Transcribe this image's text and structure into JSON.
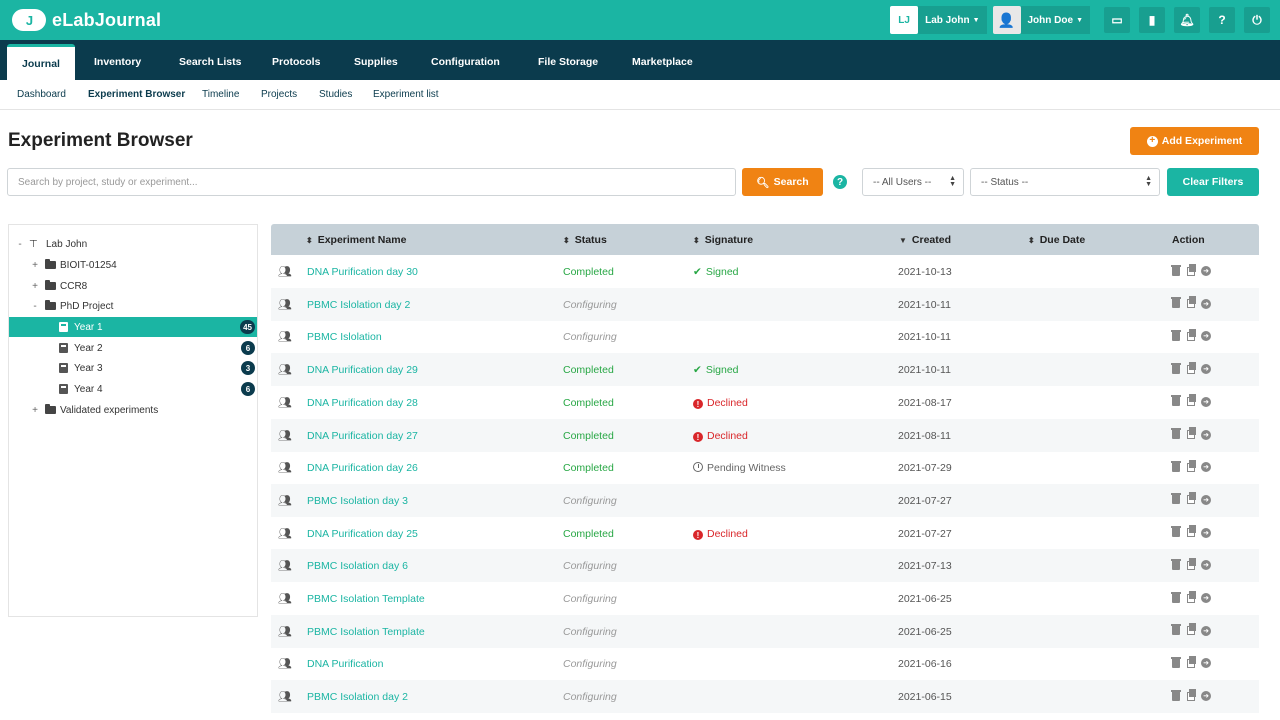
{
  "app": {
    "logo_mark": "J",
    "name": "eLabJournal"
  },
  "header": {
    "lab_avatar": "LJ",
    "lab_label": "Lab John",
    "user_label": "John Doe",
    "icons": [
      "inbox-icon",
      "chat-icon",
      "bell-icon",
      "help-icon",
      "power-icon"
    ]
  },
  "nav": {
    "tabs": [
      {
        "label": "Journal",
        "active": true
      },
      {
        "label": "Inventory"
      },
      {
        "label": "Search Lists"
      },
      {
        "label": "Protocols"
      },
      {
        "label": "Supplies"
      },
      {
        "label": "Configuration"
      },
      {
        "label": "File Storage"
      },
      {
        "label": "Marketplace"
      }
    ]
  },
  "subnav": {
    "items": [
      {
        "label": "Dashboard"
      },
      {
        "label": "Experiment Browser",
        "active": true
      },
      {
        "label": "Timeline"
      },
      {
        "label": "Projects"
      },
      {
        "label": "Studies"
      },
      {
        "label": "Experiment list"
      }
    ]
  },
  "page": {
    "title": "Experiment Browser",
    "add_label": "Add Experiment",
    "search_placeholder": "Search by project, study or experiment...",
    "search_label": "Search",
    "users_filter": "-- All Users --",
    "status_filter": "-- Status --",
    "clear_label": "Clear Filters"
  },
  "tree": {
    "items": [
      {
        "label": "Lab John",
        "toggle": "-",
        "icon": "sitemap-icon"
      },
      {
        "label": "BIOIT-01254",
        "toggle": "+",
        "icon": "folder-icon"
      },
      {
        "label": "CCR8",
        "toggle": "+",
        "icon": "folder-icon"
      },
      {
        "label": "PhD Project",
        "toggle": "-",
        "icon": "folder-icon"
      },
      {
        "label": "Year 1",
        "icon": "book-icon",
        "badge": "45",
        "selected": true
      },
      {
        "label": "Year 2",
        "icon": "book-icon",
        "badge": "6"
      },
      {
        "label": "Year 3",
        "icon": "book-icon",
        "badge": "3"
      },
      {
        "label": "Year 4",
        "icon": "book-icon",
        "badge": "6"
      },
      {
        "label": "Validated experiments",
        "toggle": "+",
        "icon": "folder-icon"
      }
    ]
  },
  "table": {
    "columns": {
      "name": "Experiment Name",
      "status": "Status",
      "signature": "Signature",
      "created": "Created",
      "due": "Due Date",
      "action": "Action"
    },
    "rows": [
      {
        "name": "DNA Purification day 30",
        "status": "Completed",
        "signature": "Signed",
        "sig_type": "signed",
        "created": "2021-10-13"
      },
      {
        "name": "PBMC Islolation day 2",
        "status": "Configuring",
        "signature": "",
        "sig_type": "",
        "created": "2021-10-11"
      },
      {
        "name": "PBMC Islolation",
        "status": "Configuring",
        "signature": "",
        "sig_type": "",
        "created": "2021-10-11"
      },
      {
        "name": "DNA Purification day 29",
        "status": "Completed",
        "signature": "Signed",
        "sig_type": "signed",
        "created": "2021-10-11"
      },
      {
        "name": "DNA Purification day 28",
        "status": "Completed",
        "signature": "Declined",
        "sig_type": "declined",
        "created": "2021-08-17"
      },
      {
        "name": "DNA Purification day 27",
        "status": "Completed",
        "signature": "Declined",
        "sig_type": "declined",
        "created": "2021-08-11"
      },
      {
        "name": "DNA Purification day 26",
        "status": "Completed",
        "signature": "Pending Witness",
        "sig_type": "pending",
        "created": "2021-07-29"
      },
      {
        "name": "PBMC Isolation day 3",
        "status": "Configuring",
        "signature": "",
        "sig_type": "",
        "created": "2021-07-27"
      },
      {
        "name": "DNA Purification day 25",
        "status": "Completed",
        "signature": "Declined",
        "sig_type": "declined",
        "created": "2021-07-27"
      },
      {
        "name": "PBMC Isolation day 6",
        "status": "Configuring",
        "signature": "",
        "sig_type": "",
        "created": "2021-07-13"
      },
      {
        "name": "PBMC Isolation Template",
        "status": "Configuring",
        "signature": "",
        "sig_type": "",
        "created": "2021-06-25"
      },
      {
        "name": "PBMC Isolation Template",
        "status": "Configuring",
        "signature": "",
        "sig_type": "",
        "created": "2021-06-25"
      },
      {
        "name": "DNA Purification",
        "status": "Configuring",
        "signature": "",
        "sig_type": "",
        "created": "2021-06-16"
      },
      {
        "name": "PBMC Isolation day 2",
        "status": "Configuring",
        "signature": "",
        "sig_type": "",
        "created": "2021-06-15"
      }
    ]
  },
  "colors": {
    "teal": "#1bb5a3",
    "navy": "#0b3b4d",
    "orange": "#f08313",
    "green": "#28a745",
    "red": "#d9262a"
  }
}
